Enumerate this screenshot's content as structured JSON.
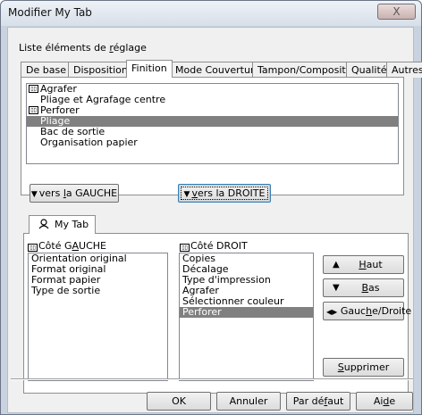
{
  "window": {
    "title": "Modifier My Tab",
    "close_glyph": "X"
  },
  "liste_label": {
    "pre": "Liste éléments de ",
    "ul": "r",
    "post": "églage"
  },
  "tabs": [
    "De base",
    "Disposition",
    "Finition",
    "Mode Couverture",
    "Tampon/Composition",
    "Qualité",
    "Autres"
  ],
  "active_tab": "Finition",
  "settings_list": [
    {
      "label": "Agrafer",
      "icon": "printer-feature-icon",
      "selected": false
    },
    {
      "label": "Pliage et Agrafage centre",
      "icon": "",
      "selected": false
    },
    {
      "label": "Perforer",
      "icon": "printer-feature-icon",
      "selected": false
    },
    {
      "label": "Pliage",
      "icon": "",
      "selected": true
    },
    {
      "label": "Bac de sortie",
      "icon": "",
      "selected": false
    },
    {
      "label": "Organisation papier",
      "icon": "",
      "selected": false
    }
  ],
  "move_left": {
    "pre": "vers ",
    "ul": "l",
    "post": "a GAUCHE"
  },
  "move_right": {
    "pre": "",
    "ul": "v",
    "post": "ers la DROITE"
  },
  "my_tab_label": "My Tab",
  "left_side": {
    "label_pre": "Côté G",
    "label_ul": "A",
    "label_post": "UCHE",
    "items": [
      "Orientation original",
      "Format original",
      "Format papier",
      "Type de sortie"
    ]
  },
  "right_side": {
    "label": "Côté DROIT",
    "items": [
      {
        "label": "Copies",
        "selected": false
      },
      {
        "label": "Décalage",
        "selected": false
      },
      {
        "label": "Type d'impression",
        "selected": false
      },
      {
        "label": "Agrafer",
        "selected": false
      },
      {
        "label": "Sélectionner couleur",
        "selected": false
      },
      {
        "label": "Perforer",
        "selected": true
      }
    ]
  },
  "side_buttons": {
    "haut": {
      "ul": "H",
      "post": "aut"
    },
    "bas": {
      "ul": "B",
      "post": "as"
    },
    "gauche_droite": {
      "pre": "Gauc",
      "ul": "h",
      "post": "e/Droite"
    },
    "supprimer": {
      "ul": "S",
      "post": "upprimer"
    }
  },
  "footer": {
    "ok": "OK",
    "annuler": "Annuler",
    "par_defaut": {
      "pre": "Par dé",
      "ul": "f",
      "post": "aut"
    },
    "aide": {
      "pre": "Ai",
      "ul": "d",
      "post": "e"
    }
  },
  "colors": {
    "selection": "#808080",
    "focus_border": "#3c7fb1",
    "chrome": "#c9d3e0"
  }
}
